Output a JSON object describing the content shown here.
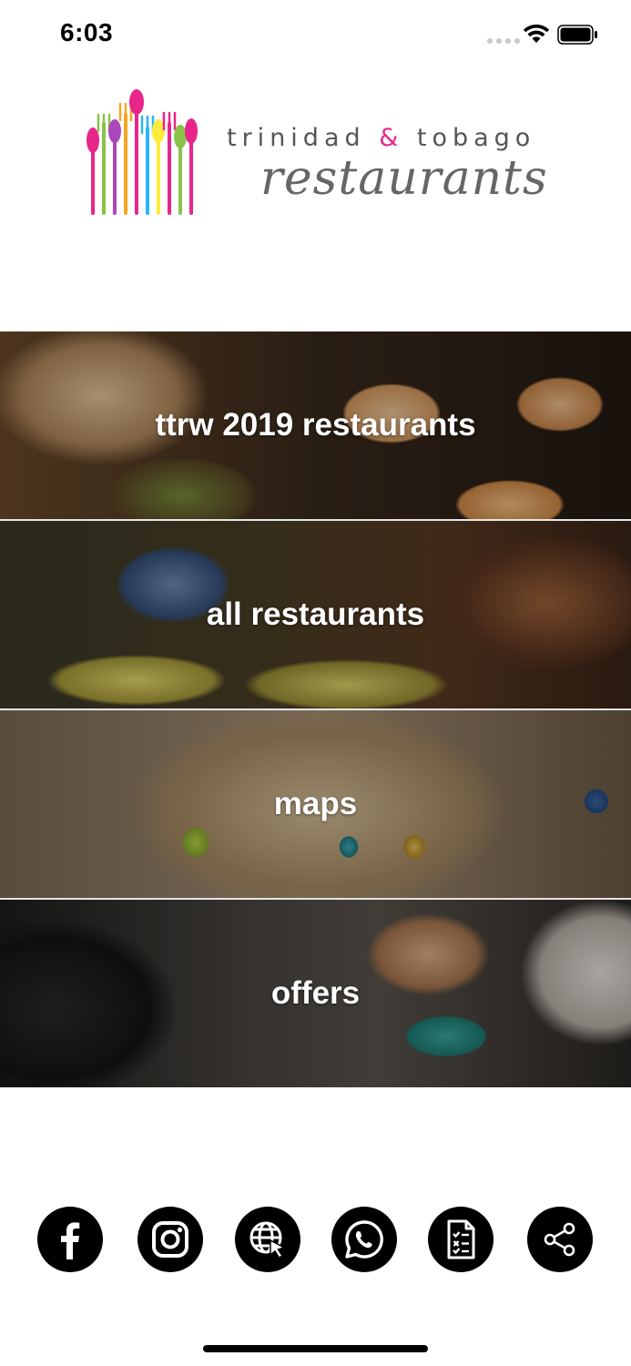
{
  "status_bar": {
    "time": "6:03"
  },
  "logo": {
    "line1_left": "trinidad",
    "line1_amp": "&",
    "line1_right": "tobago",
    "line2": "restaurants",
    "colors": [
      "#e8268a",
      "#f5a623",
      "#8bc34a",
      "#29b6f6",
      "#ab47bc",
      "#ffeb3b"
    ]
  },
  "menu": {
    "items": [
      {
        "label": "ttrw 2019 restaurants"
      },
      {
        "label": "all restaurants"
      },
      {
        "label": "maps"
      },
      {
        "label": "offers"
      }
    ]
  },
  "social": {
    "icons": [
      "facebook-icon",
      "instagram-icon",
      "website-icon",
      "whatsapp-icon",
      "document-icon",
      "share-icon"
    ]
  }
}
